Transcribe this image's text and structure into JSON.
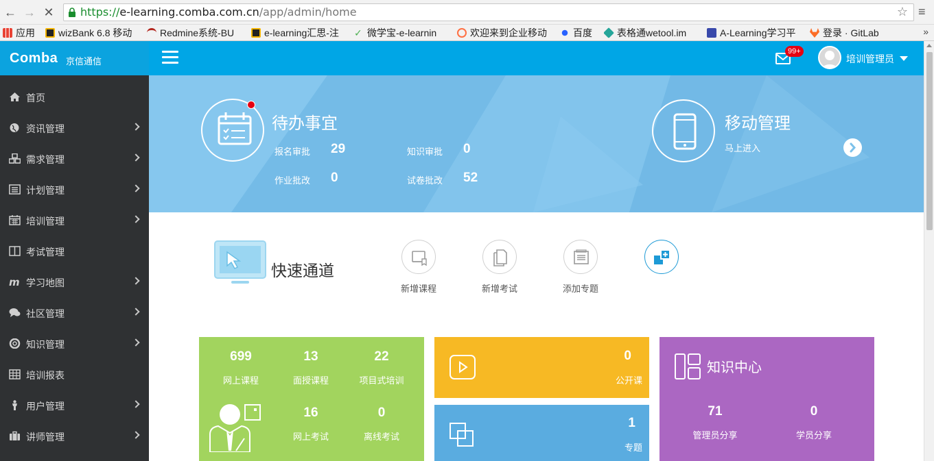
{
  "browser": {
    "url_scheme": "https://",
    "url_host": "e-learning.comba.com.cn",
    "url_path": "/app/admin/home",
    "bookmarks": [
      {
        "label": "应用",
        "color": "#e94335"
      },
      {
        "label": "wizBank 6.8 移动",
        "color": "#f4b400"
      },
      {
        "label": "Redmine系统-BU",
        "color": "#b3261e"
      },
      {
        "label": "e-learning汇思-注",
        "color": "#f4b400"
      },
      {
        "label": "微学宝-e-learnin",
        "color": "#4caf50"
      },
      {
        "label": "欢迎来到企业移动",
        "color": "#ff7043"
      },
      {
        "label": "百度",
        "color": "#2962ff"
      },
      {
        "label": "表格通wetool.im",
        "color": "#26a69a"
      },
      {
        "label": "A-Learning学习平",
        "color": "#3949ab"
      },
      {
        "label": "登录 · GitLab",
        "color": "#fc6d26"
      }
    ],
    "more_label": "»"
  },
  "header": {
    "logo_text": "Comba",
    "logo_sub": "京信通信",
    "mail_badge": "99+",
    "username": "培训管理员"
  },
  "sidebar": {
    "items": [
      {
        "label": "首页",
        "icon": "home-icon",
        "arrow": false
      },
      {
        "label": "资讯管理",
        "icon": "globe-icon",
        "arrow": true
      },
      {
        "label": "需求管理",
        "icon": "cubes-icon",
        "arrow": true
      },
      {
        "label": "计划管理",
        "icon": "list-icon",
        "arrow": true
      },
      {
        "label": "培训管理",
        "icon": "calendar-icon",
        "arrow": true
      },
      {
        "label": "考试管理",
        "icon": "columns-icon",
        "arrow": false
      },
      {
        "label": "学习地图",
        "icon": "map-icon",
        "arrow": true
      },
      {
        "label": "社区管理",
        "icon": "comments-icon",
        "arrow": true
      },
      {
        "label": "知识管理",
        "icon": "lifebuoy-icon",
        "arrow": true
      },
      {
        "label": "培训报表",
        "icon": "table-icon",
        "arrow": false
      },
      {
        "label": "用户管理",
        "icon": "user-icon",
        "arrow": true
      },
      {
        "label": "讲师管理",
        "icon": "briefcase-icon",
        "arrow": true
      }
    ]
  },
  "todo": {
    "title": "待办事宜",
    "stats": [
      {
        "label": "报名审批",
        "value": "29"
      },
      {
        "label": "知识审批",
        "value": "0"
      },
      {
        "label": "作业批改",
        "value": "0"
      },
      {
        "label": "试卷批改",
        "value": "52"
      }
    ]
  },
  "mobile": {
    "title": "移动管理",
    "subtitle": "马上进入"
  },
  "quick": {
    "title": "快速通道",
    "buttons": [
      {
        "label": "新增课程",
        "icon": "course-icon"
      },
      {
        "label": "新增考试",
        "icon": "exam-icon"
      },
      {
        "label": "添加专题",
        "icon": "topic-icon"
      }
    ]
  },
  "tiles": {
    "green": [
      {
        "value": "699",
        "label": "网上课程"
      },
      {
        "value": "13",
        "label": "面授课程"
      },
      {
        "value": "22",
        "label": "项目式培训"
      },
      {
        "value": "16",
        "label": "网上考试"
      },
      {
        "value": "0",
        "label": "离线考试"
      }
    ],
    "yellow": {
      "value": "0",
      "label": "公开课"
    },
    "blue": {
      "value": "1",
      "label": "专题"
    },
    "purple": {
      "title": "知识中心",
      "stats": [
        {
          "value": "71",
          "label": "管理员分享"
        },
        {
          "value": "0",
          "label": "学员分享"
        }
      ]
    }
  },
  "colors": {
    "header": "#00a6e6",
    "sidebar": "#2f3133",
    "banner": "#7cc1ea",
    "green_tile": "#a2d45e",
    "yellow_tile": "#f7b924",
    "blue_tile": "#5aace0",
    "purple_tile": "#ab67c2",
    "badge": "#e60012"
  }
}
